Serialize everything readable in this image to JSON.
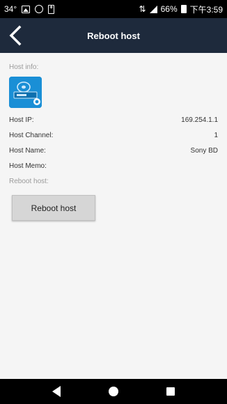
{
  "status_bar": {
    "temperature": "34°",
    "battery_percent": "66%",
    "time": "下午3:59"
  },
  "header": {
    "title": "Reboot host",
    "back_icon": "chevron-left-icon"
  },
  "host_info": {
    "section_label": "Host info:",
    "icon": "host-device-icon",
    "fields": [
      {
        "label": "Host IP:",
        "value": "169.254.1.1"
      },
      {
        "label": "Host Channel:",
        "value": "1"
      },
      {
        "label": "Host Name:",
        "value": "Sony BD"
      },
      {
        "label": "Host Memo:",
        "value": ""
      }
    ]
  },
  "reboot": {
    "section_label": "Reboot host:",
    "button_label": "Reboot host"
  },
  "colors": {
    "header_bg": "#1e2a3c",
    "content_bg": "#f5f5f5",
    "icon_bg": "#1a8fd6"
  }
}
